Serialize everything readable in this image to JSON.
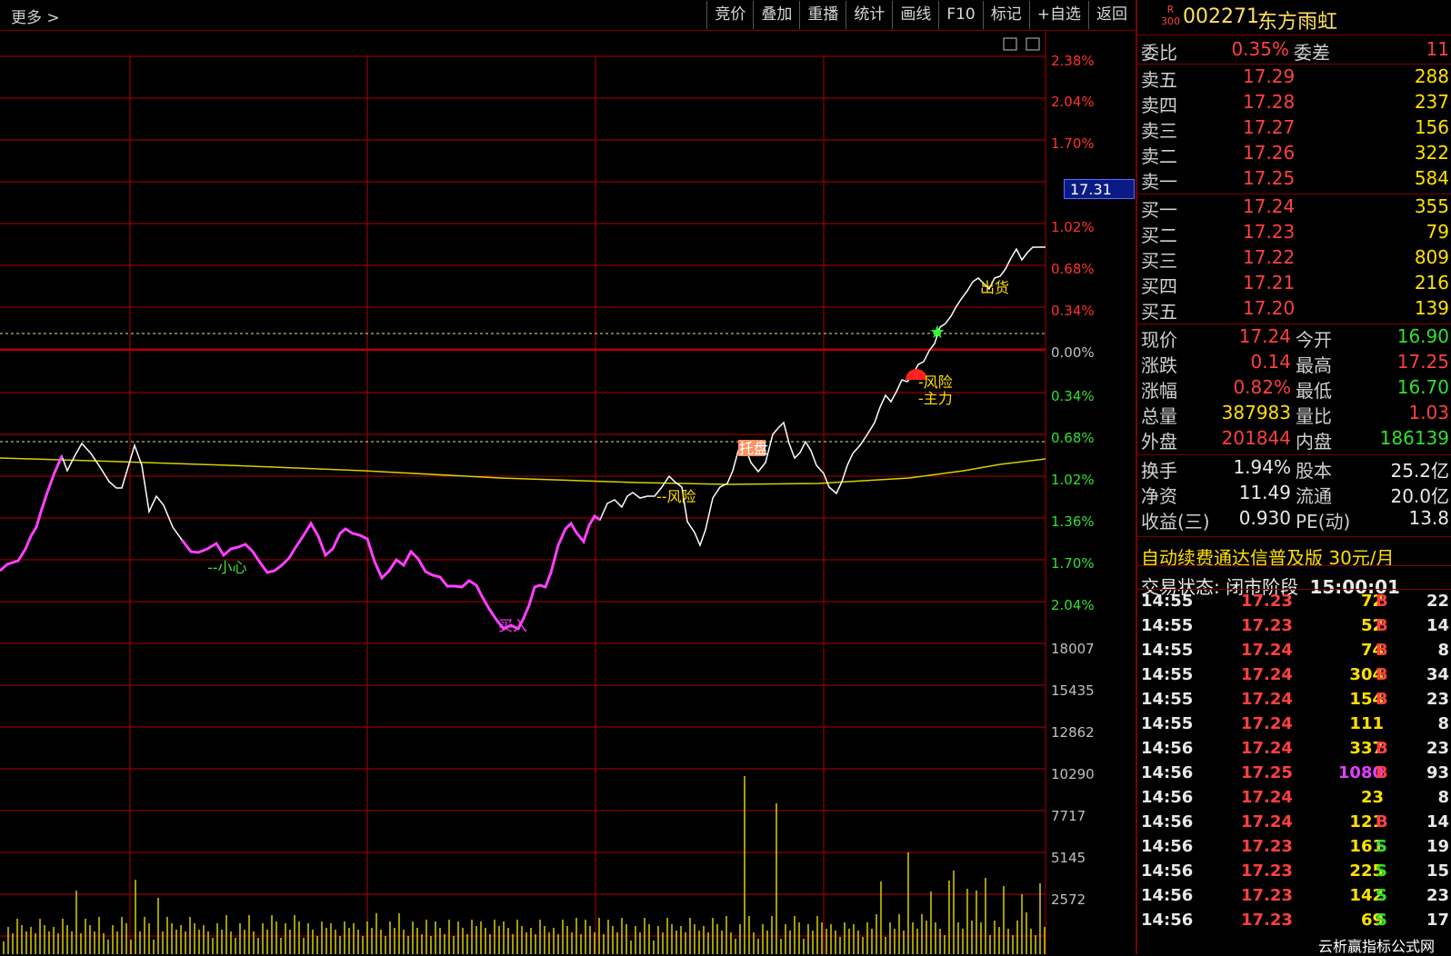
{
  "toolbar": {
    "more_label": "更多 >",
    "buttons": [
      "竞价",
      "叠加",
      "重播",
      "统计",
      "画线",
      "F10",
      "标记",
      "+自选",
      "返回"
    ]
  },
  "chart": {
    "current_price_tag": "17.31",
    "right_axis_labels": [
      "2.38%",
      "2.04%",
      "1.70%",
      "1.02%",
      "0.68%",
      "0.34%",
      "0.00%",
      "0.34%",
      "0.68%",
      "1.02%",
      "1.36%",
      "1.70%",
      "2.04%",
      "18007",
      "15435",
      "12862",
      "10290",
      "7717",
      "5145",
      "2572"
    ],
    "annotations": {
      "careful": "--小心",
      "buy": "买入",
      "risk1": "--风险",
      "bottom": "托盘",
      "risk2": "-风险",
      "main_force": "-主力",
      "ship": "出货"
    },
    "colors": {
      "grid": "#b00000",
      "price_line": "#ffffff",
      "avg_line": "#d8d000",
      "buy_zone": "#ff40ff",
      "volume": "#d8d000",
      "axis_red": "#ff3030",
      "axis_green": "#30e030",
      "axis_gray": "#c0c0c0"
    }
  },
  "quote": {
    "r_badge_top": "R",
    "r_badge_bottom": "300",
    "code": "002271",
    "name": "东方雨虹",
    "weibi_label": "委比",
    "weibi_value": "0.35%",
    "weicha_label": "委差",
    "weicha_value": "11",
    "sell": [
      {
        "label": "卖五",
        "price": "17.29",
        "vol": "288"
      },
      {
        "label": "卖四",
        "price": "17.28",
        "vol": "237"
      },
      {
        "label": "卖三",
        "price": "17.27",
        "vol": "156"
      },
      {
        "label": "卖二",
        "price": "17.26",
        "vol": "322"
      },
      {
        "label": "卖一",
        "price": "17.25",
        "vol": "584"
      }
    ],
    "buy": [
      {
        "label": "买一",
        "price": "17.24",
        "vol": "355"
      },
      {
        "label": "买二",
        "price": "17.23",
        "vol": "79"
      },
      {
        "label": "买三",
        "price": "17.22",
        "vol": "809"
      },
      {
        "label": "买四",
        "price": "17.21",
        "vol": "216"
      },
      {
        "label": "买五",
        "price": "17.20",
        "vol": "139"
      }
    ],
    "stats": [
      {
        "l1": "现价",
        "v1": "17.24",
        "c1": "red",
        "l2": "今开",
        "v2": "16.90",
        "c2": "grn"
      },
      {
        "l1": "涨跌",
        "v1": "0.14",
        "c1": "red",
        "l2": "最高",
        "v2": "17.25",
        "c2": "red"
      },
      {
        "l1": "涨幅",
        "v1": "0.82%",
        "c1": "red",
        "l2": "最低",
        "v2": "16.70",
        "c2": "grn"
      },
      {
        "l1": "总量",
        "v1": "387983",
        "c1": "yel",
        "l2": "量比",
        "v2": "1.03",
        "c2": "red"
      },
      {
        "l1": "外盘",
        "v1": "201844",
        "c1": "red",
        "l2": "内盘",
        "v2": "186139",
        "c2": "grn"
      }
    ],
    "fin": [
      {
        "l1": "换手",
        "v1": "1.94%",
        "l2": "股本",
        "v2": "25.2亿"
      },
      {
        "l1": "净资",
        "v1": "11.49",
        "l2": "流通",
        "v2": "20.0亿"
      },
      {
        "l1": "收益(三)",
        "v1": "0.930",
        "l2": "PE(动)",
        "v2": "13.8"
      }
    ],
    "promo": "自动续费通达信普及版  30元/月",
    "trade_state_label": "交易状态: 闭市阶段",
    "trade_state_time": "15:00:01"
  },
  "ticks": [
    {
      "time": "14:55",
      "price": "17.23",
      "vol": "72",
      "side": "B",
      "n": "22",
      "vc": "yel"
    },
    {
      "time": "14:55",
      "price": "17.23",
      "vol": "52",
      "side": "B",
      "n": "14",
      "vc": "yel"
    },
    {
      "time": "14:55",
      "price": "17.24",
      "vol": "74",
      "side": "B",
      "n": "8",
      "vc": "yel"
    },
    {
      "time": "14:55",
      "price": "17.24",
      "vol": "304",
      "side": "B",
      "n": "34",
      "vc": "yel"
    },
    {
      "time": "14:55",
      "price": "17.24",
      "vol": "154",
      "side": "B",
      "n": "23",
      "vc": "yel"
    },
    {
      "time": "14:55",
      "price": "17.24",
      "vol": "111",
      "side": "",
      "n": "8",
      "vc": "yel"
    },
    {
      "time": "14:56",
      "price": "17.24",
      "vol": "337",
      "side": "B",
      "n": "23",
      "vc": "yel"
    },
    {
      "time": "14:56",
      "price": "17.25",
      "vol": "1080",
      "side": "B",
      "n": "93",
      "vc": "mag"
    },
    {
      "time": "14:56",
      "price": "17.24",
      "vol": "23",
      "side": "",
      "n": "8",
      "vc": "yel"
    },
    {
      "time": "14:56",
      "price": "17.24",
      "vol": "121",
      "side": "B",
      "n": "14",
      "vc": "yel"
    },
    {
      "time": "14:56",
      "price": "17.23",
      "vol": "161",
      "side": "S",
      "n": "19",
      "vc": "yel"
    },
    {
      "time": "14:56",
      "price": "17.23",
      "vol": "225",
      "side": "S",
      "n": "15",
      "vc": "yel"
    },
    {
      "time": "14:56",
      "price": "17.23",
      "vol": "142",
      "side": "S",
      "n": "23",
      "vc": "yel"
    },
    {
      "time": "14:56",
      "price": "17.23",
      "vol": "69",
      "side": "S",
      "n": "17",
      "vc": "yel"
    }
  ],
  "watermark": "云析赢指标公式网"
}
